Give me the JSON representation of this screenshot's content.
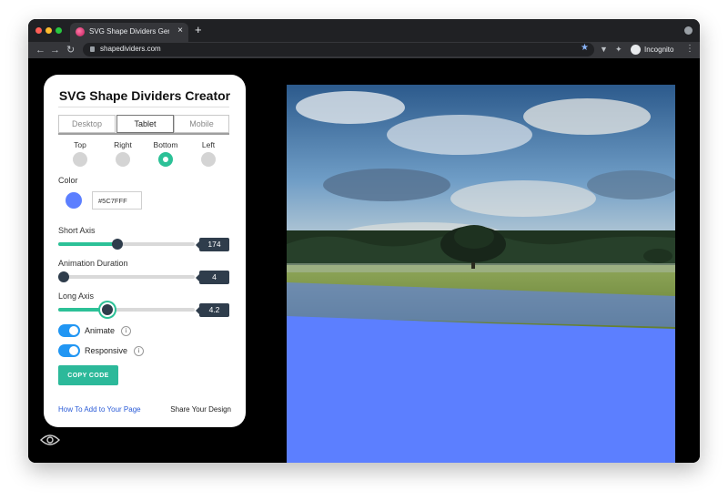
{
  "browser": {
    "tab_title": "SVG Shape Dividers Generator",
    "tab_close": "×",
    "new_tab": "+",
    "url": "shapedividers.com",
    "incognito_label": "Incognito",
    "nav": {
      "back": "←",
      "forward": "→",
      "reload": "↻"
    },
    "icons": [
      "site-favicon",
      "lock-icon",
      "star-icon",
      "vpn-extension-icon",
      "extensions-icon",
      "incognito-icon",
      "menu-icon"
    ]
  },
  "panel": {
    "title": "SVG Shape Dividers Creator",
    "device_tabs": [
      {
        "label": "Desktop",
        "active": false
      },
      {
        "label": "Tablet",
        "active": true
      },
      {
        "label": "Mobile",
        "active": false
      }
    ],
    "positions": [
      {
        "label": "Top",
        "selected": false
      },
      {
        "label": "Right",
        "selected": false
      },
      {
        "label": "Bottom",
        "selected": true
      },
      {
        "label": "Left",
        "selected": false
      }
    ],
    "color": {
      "label": "Color",
      "value": "#5C7FFF"
    },
    "sliders": [
      {
        "label": "Short Axis",
        "value": "174",
        "fraction": 0.43
      },
      {
        "label": "Animation Duration",
        "value": "4",
        "fraction": 0.04
      },
      {
        "label": "Long Axis",
        "value": "4.2",
        "fraction": 0.36
      }
    ],
    "toggles": [
      {
        "label": "Animate",
        "on": true,
        "info": "i"
      },
      {
        "label": "Responsive",
        "on": true,
        "info": "i"
      }
    ],
    "copy_button": "COPY CODE",
    "link_how": "How To Add to Your Page",
    "link_share": "Share Your Design"
  },
  "colors": {
    "accent": "#2cc197",
    "divider": "#5c7fff",
    "slider_thumb": "#2f3d4c",
    "toggle": "#2196f3"
  },
  "preview": {
    "image": "landscape photo with cloudy sky, green field and single tree",
    "divider_position": "bottom"
  }
}
